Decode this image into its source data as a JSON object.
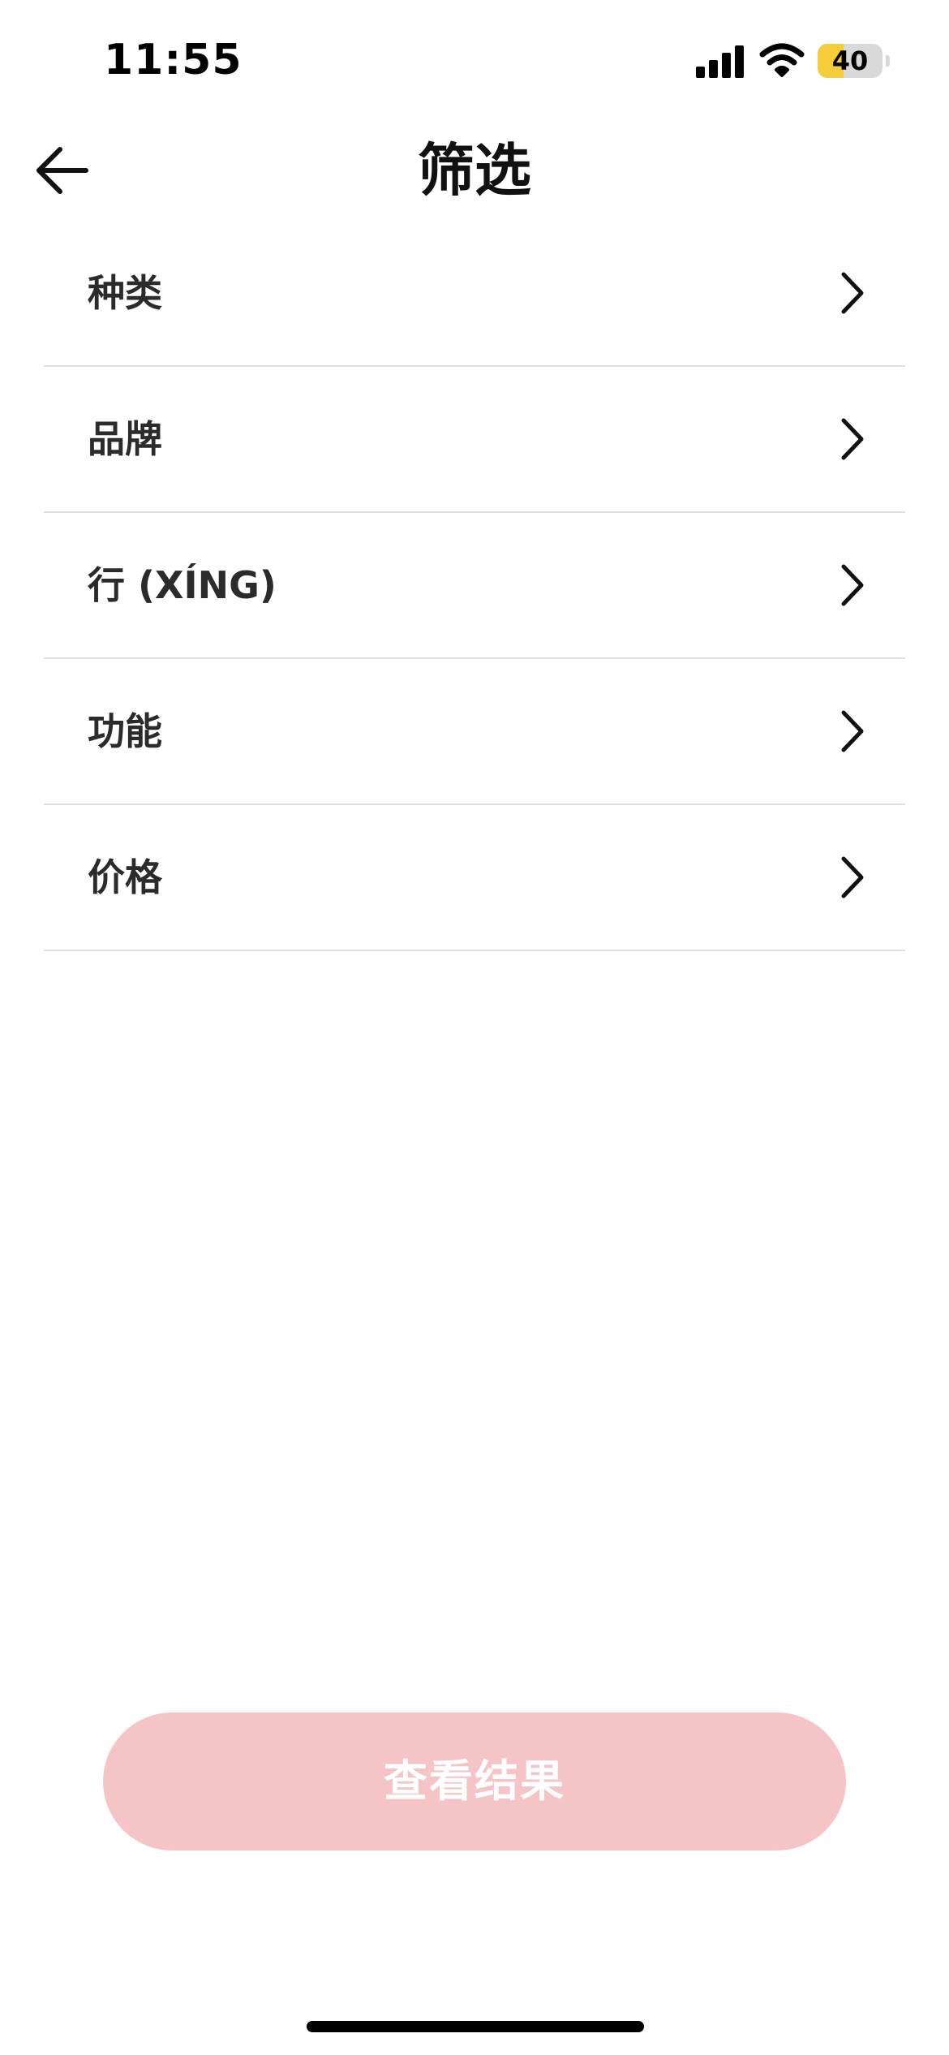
{
  "status_bar": {
    "time": "11:55",
    "battery_level": "40",
    "battery_fraction": 0.4,
    "icons": [
      "signal-icon",
      "wifi-icon",
      "battery-icon"
    ]
  },
  "header": {
    "title": "筛选",
    "back_icon": "arrow-left-icon"
  },
  "filters": [
    {
      "label": "种类",
      "icon": "chevron-right-icon"
    },
    {
      "label": "品牌",
      "icon": "chevron-right-icon"
    },
    {
      "label": "行 (XÍNG)",
      "icon": "chevron-right-icon"
    },
    {
      "label": "功能",
      "icon": "chevron-right-icon"
    },
    {
      "label": "价格",
      "icon": "chevron-right-icon"
    }
  ],
  "footer": {
    "results_button_label": "查看结果"
  },
  "colors": {
    "primary_disabled": "#f5c4c7",
    "battery_fill": "#f5cc3a",
    "divider": "#dedede"
  }
}
